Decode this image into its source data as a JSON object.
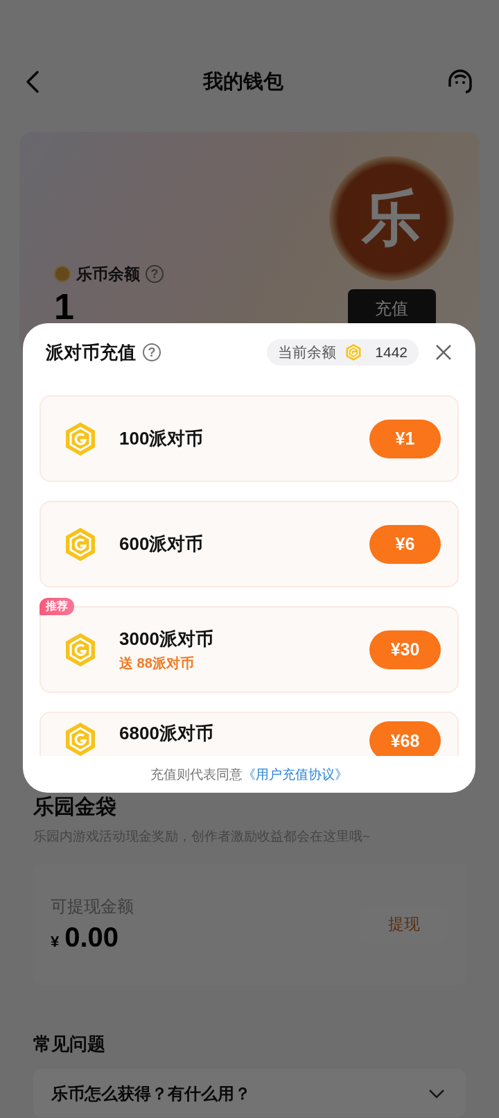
{
  "header": {
    "title": "我的钱包"
  },
  "wallet_card": {
    "coin_glyph": "乐",
    "balance_label": "乐币余额",
    "help": "?",
    "balance": "1",
    "recharge_button": "充值"
  },
  "gold_bag": {
    "title": "乐园金袋",
    "description": "乐园内游戏活动现金奖励，创作者激励收益都会在这里哦~",
    "withdrawable_label": "可提现金额",
    "currency": "¥",
    "amount": "0.00",
    "withdraw_button": "提现"
  },
  "faq": {
    "title": "常见问题",
    "items": [
      {
        "question": "乐币怎么获得？有什么用？",
        "expanded": false
      }
    ]
  },
  "recharge_dialog": {
    "title": "派对币充值",
    "help": "?",
    "balance_label": "当前余额",
    "balance": "1442",
    "packages": [
      {
        "amount": "100派对币",
        "price": "¥1"
      },
      {
        "amount": "600派对币",
        "price": "¥6"
      },
      {
        "amount": "3000派对币",
        "bonus": "送 88派对币",
        "badge": "推荐",
        "price": "¥30"
      },
      {
        "amount": "6800派对币",
        "price": "¥68"
      }
    ],
    "agreement_text": "充值则代表同意",
    "agreement_link": "《用户充值协议》"
  }
}
